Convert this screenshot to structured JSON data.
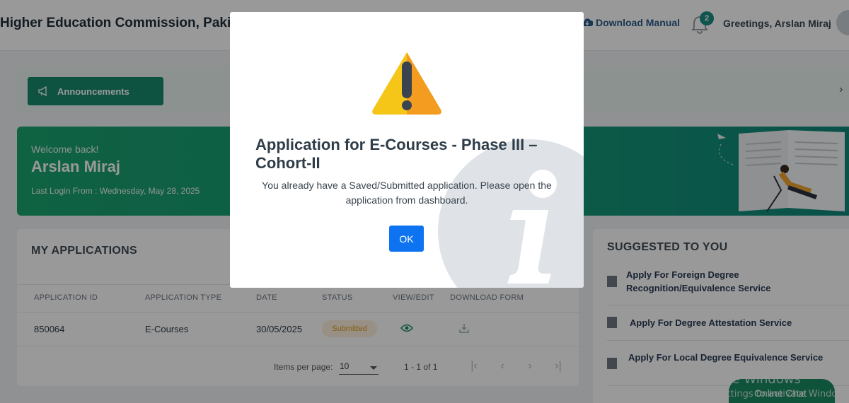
{
  "header": {
    "brand": "Higher Education Commission, Pakistan",
    "download_manual": "Download Manual",
    "notification_count": "2",
    "greeting": "Greetings, Arslan Miraj"
  },
  "announcements": {
    "label": "Announcements"
  },
  "welcome": {
    "greeting": "Welcome back!",
    "name": "Arslan Miraj",
    "last_login": "Last Login From : Wednesday, May 28, 2025"
  },
  "applications": {
    "title": "MY APPLICATIONS",
    "columns": [
      "APPLICATION ID",
      "APPLICATION TYPE",
      "DATE",
      "STATUS",
      "VIEW/EDIT",
      "DOWNLOAD FORM"
    ],
    "rows": [
      {
        "id": "850064",
        "type": "E-Courses",
        "date": "30/05/2025",
        "status": "Submitted"
      }
    ],
    "paginator": {
      "items_per_page_label": "Items per page:",
      "items_per_page": "10",
      "range": "1 - 1 of 1"
    }
  },
  "suggested": {
    "title": "SUGGESTED TO YOU",
    "items": [
      "Apply For Foreign Degree Recognition/Equivalence Service",
      "Apply For Degree Attestation Service",
      "Apply For Local Degree Equivalence Service"
    ]
  },
  "watermark": {
    "line1": "Activate Windows",
    "line2": "Go to Settings to activate Windows."
  },
  "chat": {
    "label": "Online Chat"
  },
  "modal": {
    "icon": "warning-triangle-icon",
    "title": "Application for E-Courses - Phase III – Cohort-II",
    "message": "You already have a Saved/Submitted application. Please open the application from dashboard.",
    "ok_label": "OK"
  },
  "colors": {
    "primary_green": "#1aa36f",
    "ok_blue": "#0d73f0",
    "status_submitted": "#e09a23"
  }
}
